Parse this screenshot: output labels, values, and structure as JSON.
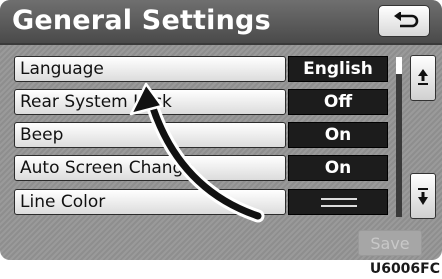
{
  "header": {
    "title": "General Settings",
    "back_icon": "return-arrow-icon"
  },
  "rows": [
    {
      "label": "Language",
      "value": "English"
    },
    {
      "label": "Rear System Lock",
      "value": "Off"
    },
    {
      "label": "Beep",
      "value": "On"
    },
    {
      "label": "Auto Screen Change",
      "value": "On"
    },
    {
      "label": "Line Color",
      "value_icon": "line-color-swatch-icon"
    }
  ],
  "pager": {
    "up_icon": "page-up-icon",
    "down_icon": "page-down-icon"
  },
  "save_label": "Save",
  "annotation_icon": "curved-arrow-icon",
  "image_code": "U6006FC",
  "colors": {
    "header": "#5a5a5a",
    "value_box": "#1c1c1c",
    "button": "#ececec"
  }
}
